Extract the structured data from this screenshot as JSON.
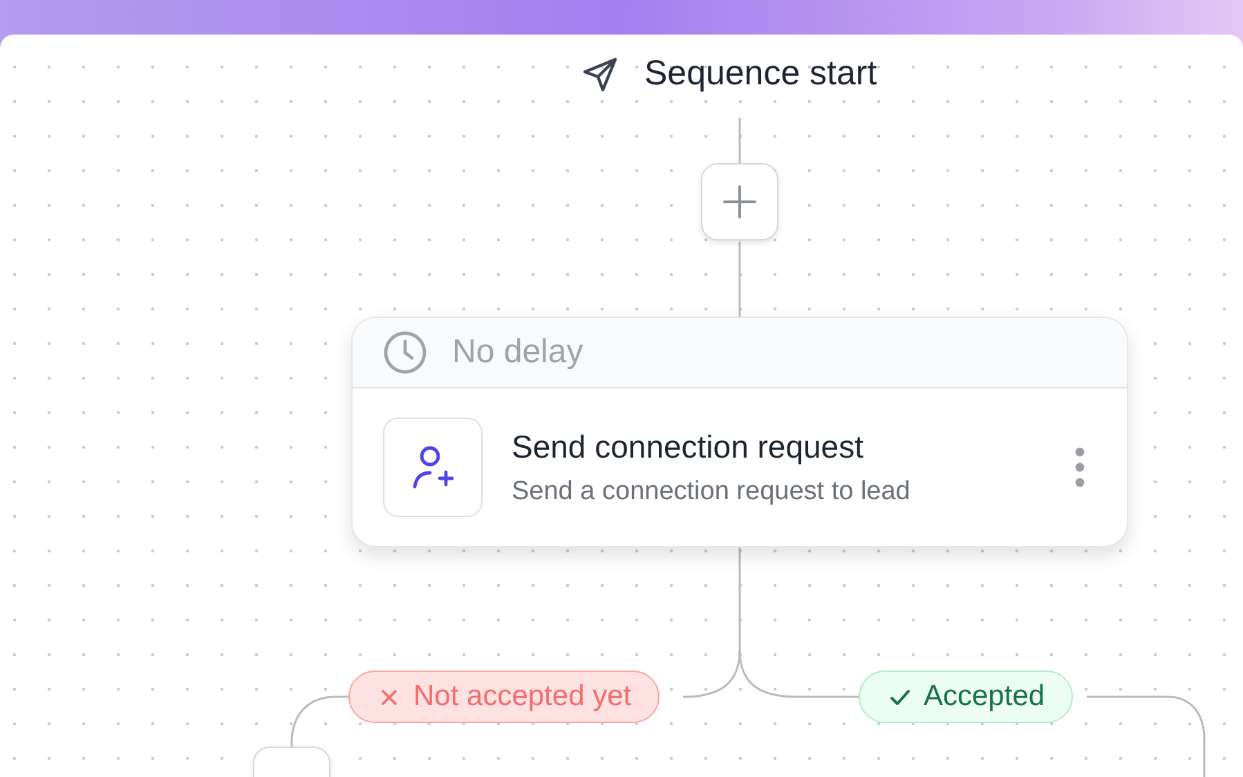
{
  "start": {
    "title": "Sequence start"
  },
  "step": {
    "delay": "No delay",
    "title": "Send connection request",
    "description": "Send a connection request to lead"
  },
  "branches": [
    {
      "kind": "not_accepted",
      "label": "Not accepted yet"
    },
    {
      "kind": "accepted",
      "label": "Accepted"
    }
  ]
}
